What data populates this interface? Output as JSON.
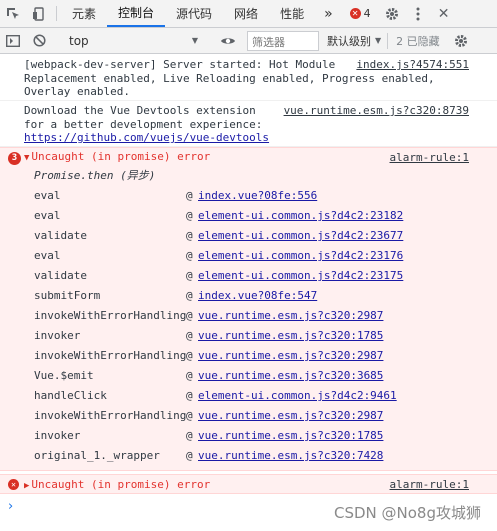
{
  "tabs": [
    {
      "label": "元素"
    },
    {
      "label": "控制台"
    },
    {
      "label": "源代码"
    },
    {
      "label": "网络"
    },
    {
      "label": "性能"
    }
  ],
  "error_count": "4",
  "toolbar": {
    "context": "top",
    "filter_placeholder": "筛选器",
    "level": "默认级别",
    "hidden": "2 已隐藏"
  },
  "messages": [
    {
      "text": "[webpack-dev-server] Server started: Hot Module\nReplacement enabled, Live Reloading enabled, Progress enabled,\nOverlay enabled.",
      "source": "index.js?4574:551"
    },
    {
      "text": "Download the Vue Devtools extension\nfor a better development experience:",
      "link": "https://github.com/vuejs/vue-devtools",
      "source": "vue.runtime.esm.js?c320:8739"
    }
  ],
  "error1": {
    "count": "3",
    "title": "Uncaught (in promise) error",
    "source": "alarm-rule:1",
    "async_label": "Promise.then (异步)",
    "frames": [
      {
        "fn": "eval",
        "loc": "index.vue?08fe:556"
      },
      {
        "fn": "eval",
        "loc": "element-ui.common.js?d4c2:23182"
      },
      {
        "fn": "validate",
        "loc": "element-ui.common.js?d4c2:23677"
      },
      {
        "fn": "eval",
        "loc": "element-ui.common.js?d4c2:23176"
      },
      {
        "fn": "validate",
        "loc": "element-ui.common.js?d4c2:23175"
      },
      {
        "fn": "submitForm",
        "loc": "index.vue?08fe:547"
      },
      {
        "fn": "invokeWithErrorHandling",
        "loc": "vue.runtime.esm.js?c320:2987"
      },
      {
        "fn": "invoker",
        "loc": "vue.runtime.esm.js?c320:1785"
      },
      {
        "fn": "invokeWithErrorHandling",
        "loc": "vue.runtime.esm.js?c320:2987"
      },
      {
        "fn": "Vue.$emit",
        "loc": "vue.runtime.esm.js?c320:3685"
      },
      {
        "fn": "handleClick",
        "loc": "element-ui.common.js?d4c2:9461"
      },
      {
        "fn": "invokeWithErrorHandling",
        "loc": "vue.runtime.esm.js?c320:2987"
      },
      {
        "fn": "invoker",
        "loc": "vue.runtime.esm.js?c320:1785"
      },
      {
        "fn": "original_1._wrapper",
        "loc": "vue.runtime.esm.js?c320:7428"
      }
    ]
  },
  "error2": {
    "title": "Uncaught (in promise) error",
    "source": "alarm-rule:1"
  },
  "watermark": "CSDN @No8g攻城狮",
  "colors": {
    "accent": "#1a73e8",
    "error": "#d93025",
    "link": "#1a1aa6"
  }
}
